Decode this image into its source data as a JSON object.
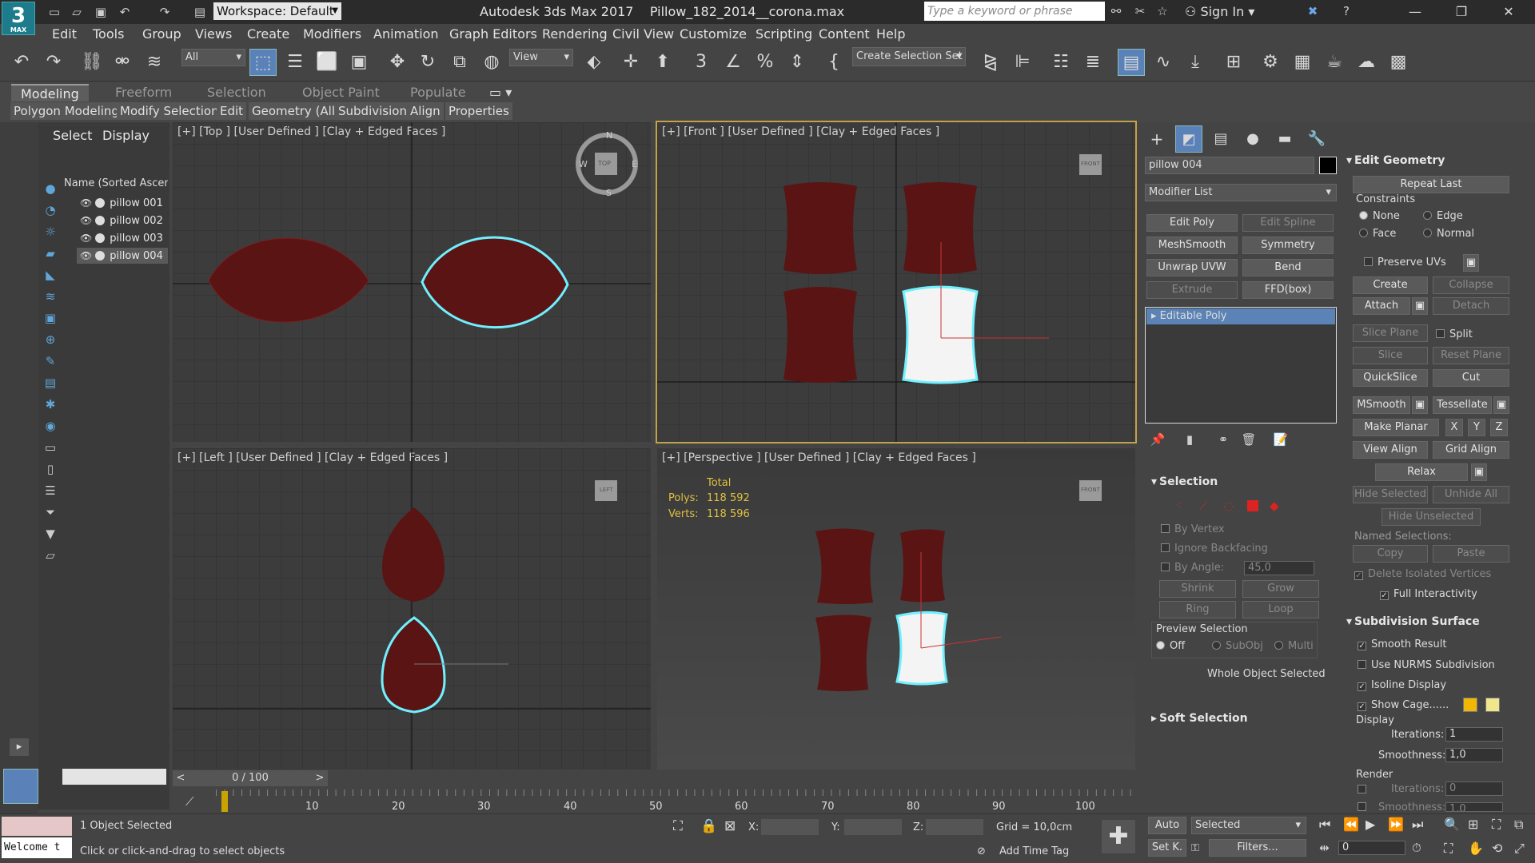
{
  "app": {
    "title": "Autodesk 3ds Max 2017",
    "file": "Pillow_182_2014__corona.max",
    "logo_text": "3",
    "logo_sub": "MAX",
    "workspace": "Workspace: Default",
    "search_placeholder": "Type a keyword or phrase",
    "sign_in": "Sign In"
  },
  "menus": [
    "Edit",
    "Tools",
    "Group",
    "Views",
    "Create",
    "Modifiers",
    "Animation",
    "Graph Editors",
    "Rendering",
    "Civil View",
    "Customize",
    "Scripting",
    "Content",
    "Help"
  ],
  "toolbar": {
    "selection_filter": "All",
    "reference_coord": "View",
    "named_selection": "Create Selection Set"
  },
  "ribbon": {
    "tabs": [
      "Modeling",
      "Freeform",
      "Selection",
      "Object Paint",
      "Populate"
    ],
    "subtabs": [
      "Polygon Modeling",
      "Modify Selection",
      "Edit",
      "Geometry (All)",
      "Subdivision",
      "Align",
      "Properties"
    ]
  },
  "scene_explorer": {
    "tabs": [
      "Select",
      "Display"
    ],
    "header": "Name (Sorted Ascending)",
    "items": [
      {
        "name": "pillow 001",
        "selected": false
      },
      {
        "name": "pillow 002",
        "selected": false
      },
      {
        "name": "pillow 003",
        "selected": false
      },
      {
        "name": "pillow 004",
        "selected": true
      }
    ]
  },
  "viewports": {
    "top": {
      "label": "[+] [Top ] [User Defined ] [Clay + Edged Faces ]",
      "cube": "TOP"
    },
    "front": {
      "label": "[+] [Front ] [User Defined ] [Clay + Edged Faces ]",
      "cube": "FRONT"
    },
    "left": {
      "label": "[+] [Left ] [User Defined ] [Clay + Edged Faces ]",
      "cube": "LEFT"
    },
    "perspective": {
      "label": "[+] [Perspective ] [User Defined ] [Clay + Edged Faces ]",
      "cube": "FRONT"
    },
    "stats": {
      "total_label": "Total",
      "polys_label": "Polys:",
      "polys": "118 592",
      "verts_label": "Verts:",
      "verts": "118 596"
    },
    "compass": {
      "n": "N",
      "s": "S",
      "e": "E",
      "w": "W"
    }
  },
  "command_panel": {
    "object_name": "pillow 004",
    "object_color": "#000000",
    "modifier_list": "Modifier List",
    "mod_buttons": [
      {
        "label": "Edit Poly",
        "enabled": true
      },
      {
        "label": "Edit Spline",
        "enabled": false
      },
      {
        "label": "MeshSmooth",
        "enabled": true
      },
      {
        "label": "Symmetry",
        "enabled": true
      },
      {
        "label": "Unwrap UVW",
        "enabled": true
      },
      {
        "label": "Bend",
        "enabled": true
      },
      {
        "label": "Extrude",
        "enabled": false
      },
      {
        "label": "FFD(box)",
        "enabled": true
      }
    ],
    "stack_item": "Editable Poly",
    "selection": {
      "title": "Selection",
      "by_vertex": "By Vertex",
      "ignore_backfacing": "Ignore Backfacing",
      "by_angle": "By Angle:",
      "angle_value": "45,0",
      "shrink": "Shrink",
      "grow": "Grow",
      "ring": "Ring",
      "loop": "Loop",
      "preview_title": "Preview Selection",
      "preview_off": "Off",
      "preview_subobj": "SubObj",
      "preview_multi": "Multi",
      "status": "Whole Object Selected"
    },
    "soft_selection": "Soft Selection"
  },
  "edit_geometry": {
    "title": "Edit Geometry",
    "repeat_last": "Repeat Last",
    "constraints": "Constraints",
    "c_none": "None",
    "c_edge": "Edge",
    "c_face": "Face",
    "c_normal": "Normal",
    "preserve_uvs": "Preserve UVs",
    "create": "Create",
    "collapse": "Collapse",
    "attach": "Attach",
    "detach": "Detach",
    "slice_plane": "Slice Plane",
    "split": "Split",
    "slice": "Slice",
    "reset_plane": "Reset Plane",
    "quickslice": "QuickSlice",
    "cut": "Cut",
    "msmooth": "MSmooth",
    "tessellate": "Tessellate",
    "make_planar": "Make Planar",
    "x": "X",
    "y": "Y",
    "z": "Z",
    "view_align": "View Align",
    "grid_align": "Grid Align",
    "relax": "Relax",
    "hide_selected": "Hide Selected",
    "unhide_all": "Unhide All",
    "hide_unselected": "Hide Unselected",
    "named_selections": "Named Selections:",
    "copy": "Copy",
    "paste": "Paste",
    "delete_isolated": "Delete Isolated Vertices",
    "full_interactivity": "Full Interactivity"
  },
  "subdivision": {
    "title": "Subdivision Surface",
    "smooth_result": "Smooth Result",
    "use_nurms": "Use NURMS Subdivision",
    "isoline": "Isoline Display",
    "show_cage": "Show Cage......",
    "cage_color1": "#f2b705",
    "cage_color2": "#f0e68c",
    "display": "Display",
    "iterations": "Iterations:",
    "iterations_val": "1",
    "smoothness": "Smoothness:",
    "smoothness_val": "1,0",
    "render": "Render",
    "r_iterations": "Iterations:",
    "r_iterations_val": "0",
    "r_smoothness": "Smoothness:",
    "r_smoothness_val": "1,0"
  },
  "timeline": {
    "frame": "0 / 100",
    "ticks": [
      "10",
      "20",
      "30",
      "40",
      "50",
      "60",
      "70",
      "80",
      "90",
      "100"
    ]
  },
  "status": {
    "maxscript": "Welcome t",
    "selected": "1 Object Selected",
    "prompt": "Click or click-and-drag to select objects",
    "x_label": "X:",
    "y_label": "Y:",
    "z_label": "Z:",
    "grid": "Grid = 10,0cm",
    "add_time_tag": "Add Time Tag",
    "auto": "Auto",
    "selected_dd": "Selected",
    "set_key": "Set K.",
    "filters": "Filters...",
    "frame_val": "0"
  },
  "colors": {
    "pillow": "#5a1414",
    "selection_outline": "#6ff0ff",
    "accent": "#5c83b5"
  }
}
